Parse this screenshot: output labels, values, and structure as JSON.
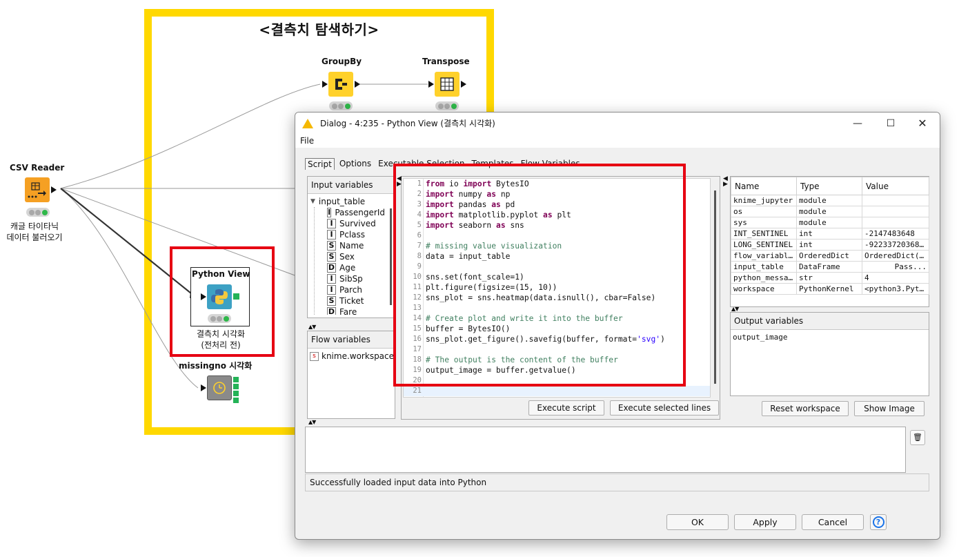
{
  "canvas": {
    "annotation_title": "<결측치 탐색하기>",
    "nodes": {
      "csv_reader": {
        "title": "CSV Reader",
        "sub1": "캐글 타이타닉",
        "sub2": "데이터 불러오기"
      },
      "groupby": {
        "title": "GroupBy"
      },
      "transpose": {
        "title": "Transpose"
      },
      "python_view": {
        "title": "Python View",
        "sub1": "결측치 시각화",
        "sub2": "(전처리 전)"
      },
      "missingno": {
        "title": "missingno 시각화"
      }
    },
    "colors": {
      "annotation": "#FFD800",
      "highlight": "#E60012",
      "node_orange": "#F5A023",
      "node_yellow": "#FFD12B"
    }
  },
  "dialog": {
    "title": "Dialog - 4:235 - Python View (결측치 시각화)",
    "menu": [
      "File"
    ],
    "tabs": [
      "Script",
      "Options",
      "Executable Selection",
      "Templates",
      "Flow Variables"
    ],
    "input_variables": {
      "header": "Input variables",
      "root": "input_table",
      "columns": [
        {
          "type": "I",
          "name": "PassengerId"
        },
        {
          "type": "I",
          "name": "Survived"
        },
        {
          "type": "I",
          "name": "Pclass"
        },
        {
          "type": "S",
          "name": "Name"
        },
        {
          "type": "S",
          "name": "Sex"
        },
        {
          "type": "D",
          "name": "Age"
        },
        {
          "type": "I",
          "name": "SibSp"
        },
        {
          "type": "I",
          "name": "Parch"
        },
        {
          "type": "S",
          "name": "Ticket"
        },
        {
          "type": "D",
          "name": "Fare"
        }
      ]
    },
    "flow_variables": {
      "header": "Flow variables",
      "items": [
        "knime.workspace"
      ],
      "item_icon": "s"
    },
    "code_lines": [
      "from io import BytesIO",
      "import numpy as np",
      "import pandas as pd",
      "import matplotlib.pyplot as plt",
      "import seaborn as sns",
      "",
      "# missing value visualization",
      "data = input_table",
      "",
      "sns.set(font_scale=1)",
      "plt.figure(figsize=(15, 10))",
      "sns_plot = sns.heatmap(data.isnull(), cbar=False)",
      "",
      "# Create plot and write it into the buffer",
      "buffer = BytesIO()",
      "sns_plot.get_figure().savefig(buffer, format='svg')",
      "",
      "# The output is the content of the buffer",
      "output_image = buffer.getvalue()",
      "",
      ""
    ],
    "buttons": {
      "execute_script": "Execute script",
      "execute_selected": "Execute selected lines",
      "reset_workspace": "Reset workspace",
      "show_image": "Show Image",
      "ok": "OK",
      "apply": "Apply",
      "cancel": "Cancel",
      "help": "?"
    },
    "workspace": {
      "headers": [
        "Name",
        "Type",
        "Value"
      ],
      "rows": [
        [
          "knime_jupyter",
          "module",
          ""
        ],
        [
          "os",
          "module",
          ""
        ],
        [
          "sys",
          "module",
          ""
        ],
        [
          "INT_SENTINEL",
          "int",
          "-2147483648"
        ],
        [
          "LONG_SENTINEL",
          "int",
          "-92233720368..."
        ],
        [
          "flow_variables",
          "OrderedDict",
          "OrderedDict(..."
        ],
        [
          "input_table",
          "DataFrame",
          "Pass..."
        ],
        [
          "python_messa...",
          "str",
          "4"
        ],
        [
          "workspace",
          "PythonKernel",
          "<python3.Pyt..."
        ]
      ]
    },
    "output_variables": {
      "header": "Output variables",
      "items": [
        "output_image"
      ]
    },
    "status": "Successfully loaded input data into Python"
  }
}
